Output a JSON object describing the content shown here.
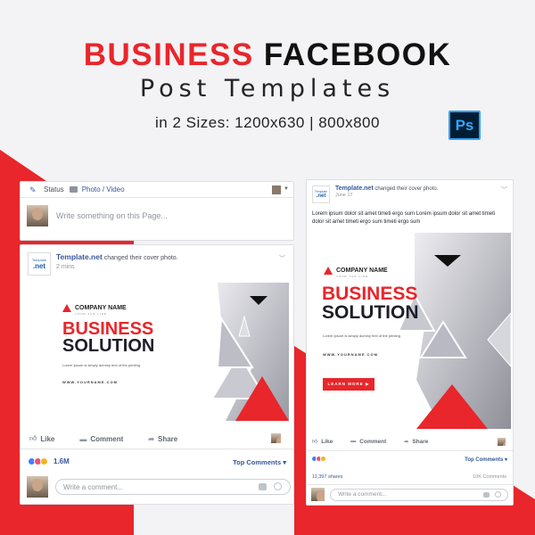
{
  "header": {
    "title_red": "BUSINESS",
    "title_black": "FACEBOOK",
    "subtitle": "Post Templates",
    "sizes": "in 2 Sizes:  1200x630  |  800x800",
    "ps_badge": "Ps"
  },
  "colors": {
    "accent": "#e8262b",
    "facebook_blue": "#365899",
    "background": "#f3f3f5"
  },
  "status_card": {
    "status_label": "Status",
    "photo_label": "Photo / Video",
    "placeholder": "Write something on this Page..."
  },
  "post1": {
    "page_logo_top": "Template",
    "page_logo_bottom": ".net",
    "page_name": "Template.net",
    "action": " changed their cover photo.",
    "time": "2 mins",
    "ad": {
      "company": "COMPANY NAME",
      "tagline": "YOUR TAG LINE",
      "headline_1": "BUSINESS",
      "headline_2": "SOLUTION",
      "lorem": "Lorem Ipsum is simply dummy text of the printing",
      "website": "WWW.YOURNAME.COM"
    },
    "like": "Like",
    "comment": "Comment",
    "share": "Share",
    "reactions_count": "1.6M",
    "top_comments": "Top Comments ▾",
    "comment_placeholder": "Write a comment..."
  },
  "post2": {
    "page_logo_top": "Template",
    "page_logo_bottom": ".net",
    "page_name": "Template.net",
    "action": " changed their cover photo.",
    "time": "June 17",
    "text": "Lorem ipsum dolor sit amet timeti ergo sum Lorem ipsum dolor sit amet timeti dolor sit amet timeti ergo sum timeti ergo sum",
    "ad": {
      "company": "COMPANY NAME",
      "tagline": "YOUR TAG LINE",
      "headline_1": "BUSINESS",
      "headline_2": "SOLUTION",
      "lorem": "Lorem Ipsum is simply dummy text of the printing",
      "website": "WWW.YOURNAME.COM",
      "cta": "LEARN MORE ▶"
    },
    "like": "Like",
    "comment": "Comment",
    "share": "Share",
    "top_comments": "Top Comments ▾",
    "shares": "11,397 shares",
    "comments_count": "10K Comments",
    "comment_placeholder": "Write a comment..."
  }
}
